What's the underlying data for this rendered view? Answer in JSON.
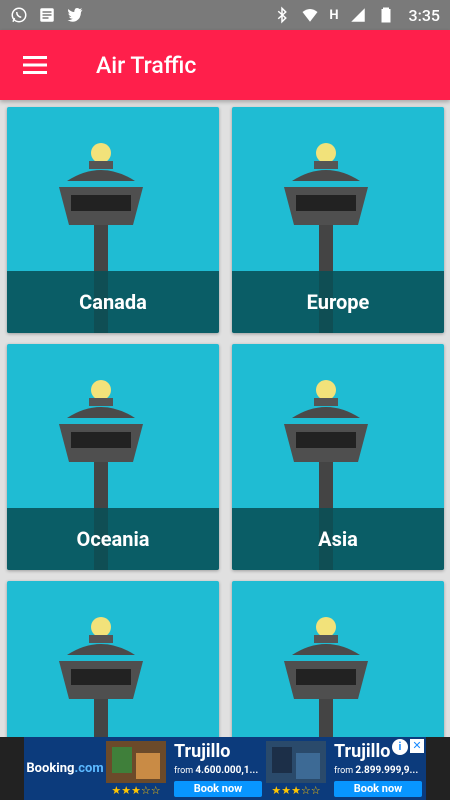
{
  "status_bar": {
    "time": "3:35",
    "left_icons": [
      "whatsapp-icon",
      "message-icon",
      "twitter-icon"
    ],
    "right_icons": [
      "bluetooth-icon",
      "wifi-icon",
      "h-signal-icon",
      "signal-icon",
      "battery-icon"
    ],
    "network_letter": "H"
  },
  "app_bar": {
    "title": "Air Traffic",
    "menu_icon": "hamburger-menu-icon",
    "color": "#ff1f4b"
  },
  "tiles": [
    {
      "label": "Canada"
    },
    {
      "label": "Europe"
    },
    {
      "label": "Oceania"
    },
    {
      "label": "Asia"
    },
    {
      "label": ""
    },
    {
      "label": ""
    }
  ],
  "colors": {
    "tile_bg": "#1fbcd3",
    "label_band": "#085056"
  },
  "ad": {
    "brand_name": "Booking",
    "brand_suffix": ".com",
    "cards": [
      {
        "city": "Trujillo",
        "from_label": "from",
        "price": "4.600.000,1...",
        "cta": "Book now",
        "stars": "★★★☆☆"
      },
      {
        "city": "Trujillo",
        "from_label": "from",
        "price": "2.899.999,9...",
        "cta": "Book now",
        "stars": "★★★☆☆"
      }
    ],
    "info_symbol": "i",
    "close_symbol": "✕"
  }
}
